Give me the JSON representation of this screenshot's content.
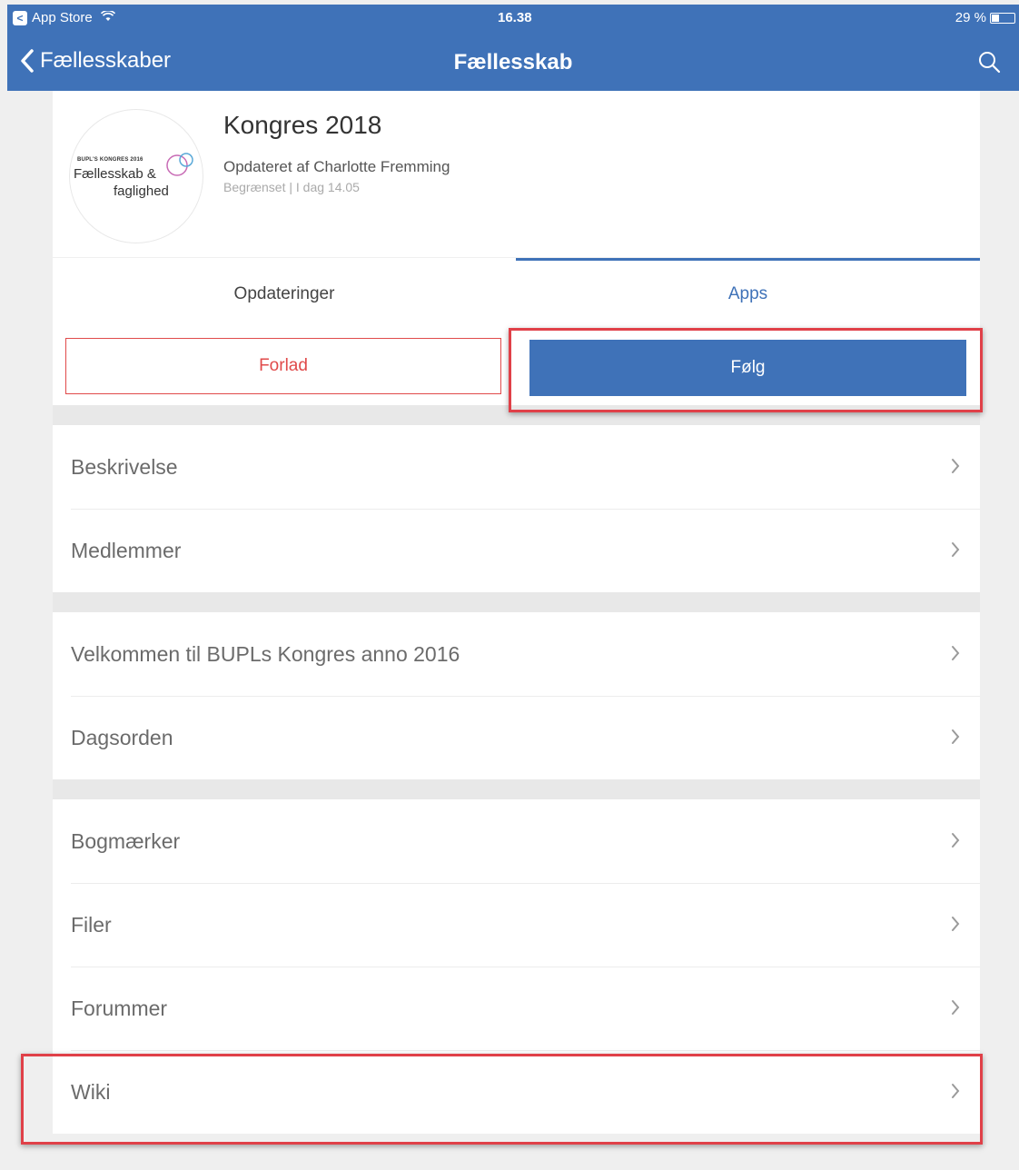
{
  "status_bar": {
    "carrier": "App Store",
    "time": "16.38",
    "battery": "29 %"
  },
  "navbar": {
    "back_label": "Fællesskaber",
    "title": "Fællesskab"
  },
  "community": {
    "logo_small_text": "BUPL'S KONGRES 2016",
    "logo_line1": "Fællesskab &",
    "logo_line2": "faglighed",
    "title": "Kongres 2018",
    "updated_by": "Opdateret af Charlotte Fremming",
    "meta": "Begrænset | I dag 14.05"
  },
  "tabs": [
    {
      "label": "Opdateringer",
      "active": false
    },
    {
      "label": "Apps",
      "active": true
    }
  ],
  "actions": {
    "leave_label": "Forlad",
    "follow_label": "Følg"
  },
  "groups": [
    [
      {
        "label": "Beskrivelse"
      },
      {
        "label": "Medlemmer"
      }
    ],
    [
      {
        "label": "Velkommen til BUPLs Kongres anno 2016"
      },
      {
        "label": "Dagsorden"
      }
    ],
    [
      {
        "label": "Bogmærker"
      },
      {
        "label": "Filer"
      },
      {
        "label": "Forummer"
      },
      {
        "label": "Wiki"
      }
    ]
  ],
  "colors": {
    "header": "#3f72b8",
    "accent": "#3f72b8",
    "danger": "#e04a4a",
    "annotation": "#e04048"
  }
}
